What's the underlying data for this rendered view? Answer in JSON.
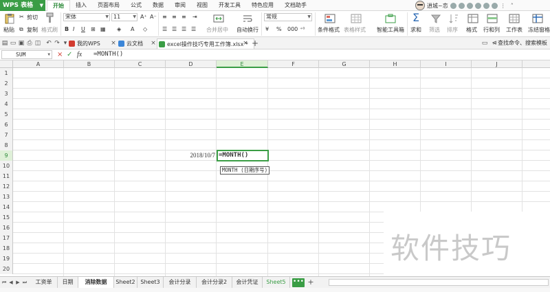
{
  "menubar": {
    "app_label": "WPS 表格",
    "tabs": [
      "开始",
      "插入",
      "页面布局",
      "公式",
      "数据",
      "审阅",
      "视图",
      "开发工具",
      "特色应用",
      "文档助手"
    ],
    "user_name": "逍城~恋"
  },
  "ribbon": {
    "paste": "粘贴",
    "cut": "剪切",
    "copy": "复制",
    "format_painter": "格式刷",
    "font_name": "宋体",
    "font_size": "11",
    "bold": "B",
    "italic": "I",
    "underline": "U",
    "merge_center": "合并居中",
    "wrap_text": "自动换行",
    "number_format": "常规",
    "percent": "%",
    "conditional_format": "条件格式",
    "table_style": "表格样式",
    "smart_toolbox": "智能工具箱",
    "sum": "求和",
    "filter": "筛选",
    "sort": "排序",
    "format": "格式",
    "rows_cols": "行和列",
    "worksheet": "工作表",
    "freeze_panes": "冻结窗格"
  },
  "quickbar": {
    "tab_mywps": "我的WPS",
    "tab_cloud": "云文档",
    "tab_workbook": "excel操作技巧专用工作簿.xlsx *",
    "search_command": "查找命令、搜索模板"
  },
  "formula_bar": {
    "name_box": "SUM",
    "cancel": "×",
    "confirm": "✓",
    "fx": "fx",
    "content": "=MONTH()"
  },
  "grid": {
    "columns": [
      "A",
      "B",
      "C",
      "D",
      "E",
      "F",
      "G",
      "H",
      "I",
      "J"
    ],
    "rows": [
      "1",
      "2",
      "3",
      "4",
      "5",
      "6",
      "7",
      "8",
      "9",
      "10",
      "11",
      "12",
      "13",
      "14",
      "15",
      "16",
      "17",
      "18",
      "19",
      "20"
    ],
    "date_cell": "2018/10/7",
    "active_cell_text": "=MONTH()",
    "tooltip": "MONTH (日期序号)"
  },
  "sheet_tabs": [
    "工资单",
    "日期",
    "消除数据",
    "Sheet2",
    "Sheet3",
    "会计分录",
    "会计分录2",
    "会计凭证",
    "Sheet5"
  ],
  "sheet_more": "•••",
  "sheet_add": "+",
  "watermark": "软件技巧"
}
